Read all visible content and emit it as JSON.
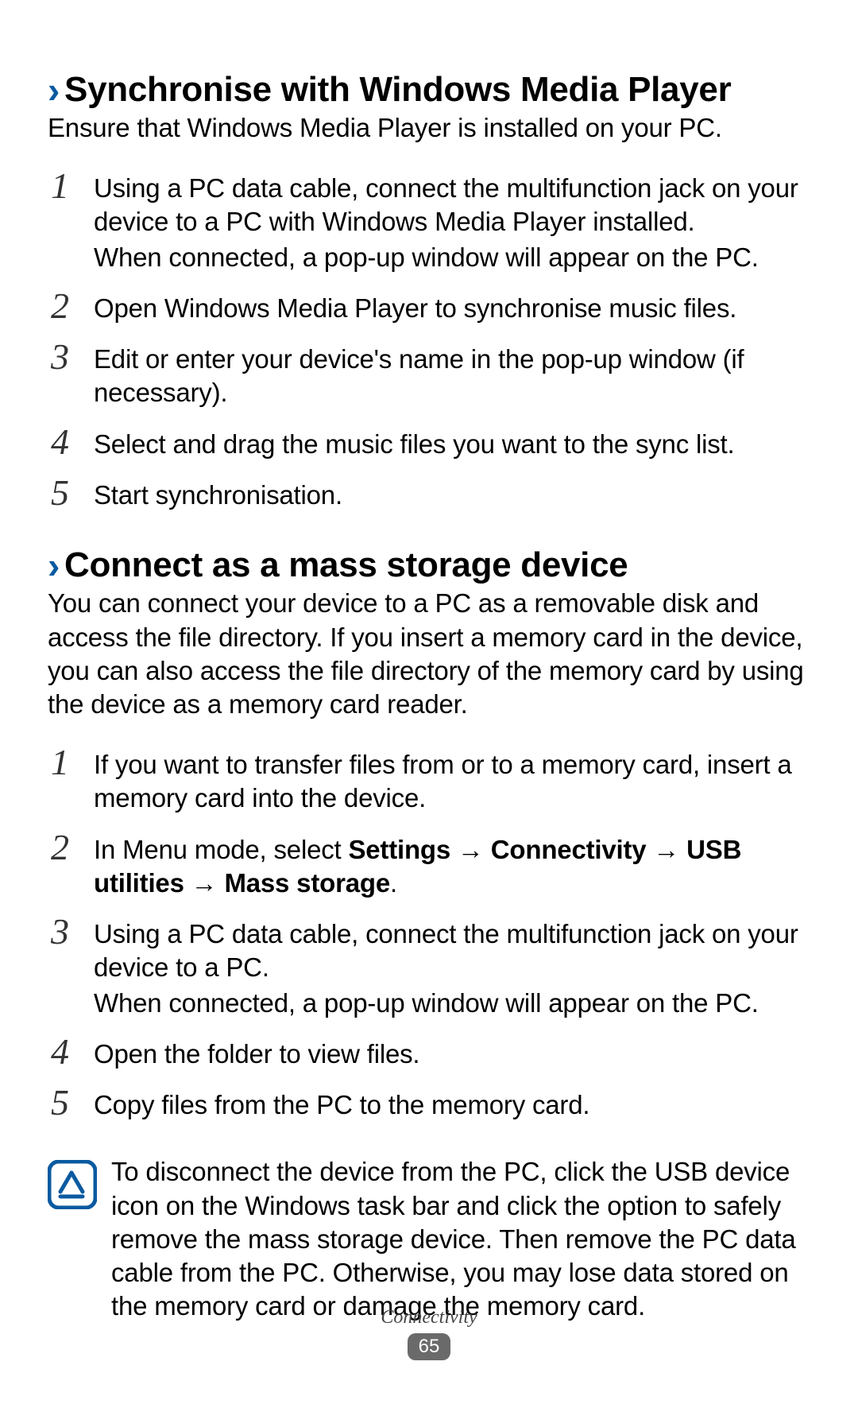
{
  "section1": {
    "heading": "Synchronise with Windows Media Player",
    "intro": "Ensure that Windows Media Player is installed on your PC.",
    "steps": [
      {
        "num": "1",
        "text": "Using a PC data cable, connect the multifunction jack on your device to a PC with Windows Media Player installed.",
        "extra": "When connected, a pop-up window will appear on the PC."
      },
      {
        "num": "2",
        "text": "Open Windows Media Player to synchronise music files."
      },
      {
        "num": "3",
        "text": "Edit or enter your device's name in the pop-up window (if necessary)."
      },
      {
        "num": "4",
        "text": "Select and drag the music files you want to the sync list."
      },
      {
        "num": "5",
        "text": "Start synchronisation."
      }
    ]
  },
  "section2": {
    "heading": "Connect as a mass storage device",
    "intro": "You can connect your device to a PC as a removable disk and access the file directory. If you insert a memory card in the device, you can also access the file directory of the memory card by using the device as a memory card reader.",
    "steps": [
      {
        "num": "1",
        "text": "If you want to transfer files from or to a memory card, insert a memory card into the device."
      },
      {
        "num": "2",
        "lead": "In Menu mode, select ",
        "bold": "Settings → Connectivity → USB utilities → Mass storage",
        "tail": "."
      },
      {
        "num": "3",
        "text": "Using a PC data cable, connect the multifunction jack on your device to a PC.",
        "extra": "When connected, a pop-up window will appear on the PC."
      },
      {
        "num": "4",
        "text": "Open the folder to view files."
      },
      {
        "num": "5",
        "text": "Copy files from the PC to the memory card."
      }
    ],
    "note": "To disconnect the device from the PC, click the USB device icon on the Windows task bar and click the option to safely remove the mass storage device. Then remove the PC data cable from the PC. Otherwise, you may lose data stored on the memory card or damage the memory card."
  },
  "footer": {
    "section": "Connectivity",
    "page": "65"
  }
}
